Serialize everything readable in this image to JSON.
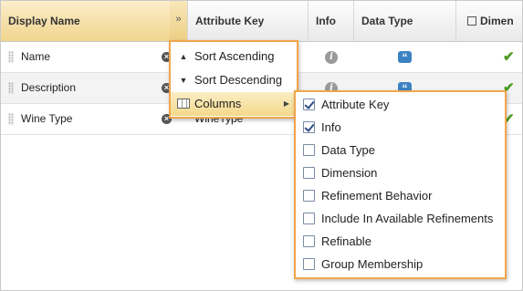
{
  "columns": {
    "display_name": "Display Name",
    "attribute_key": "Attribute Key",
    "info": "Info",
    "data_type": "Data Type",
    "dimension": "Dimen"
  },
  "trigger_glyph": "»",
  "rows": [
    {
      "name": "Name",
      "key": "",
      "info_glyph": "i",
      "type_glyph": "“",
      "dimension_checked": true
    },
    {
      "name": "Description",
      "key": "",
      "info_glyph": "i",
      "type_glyph": "“",
      "dimension_checked": true
    },
    {
      "name": "Wine Type",
      "key": "WineType",
      "info_glyph": "i",
      "type_glyph": "“",
      "dimension_checked": true
    }
  ],
  "column_menu": {
    "sort_ascending": "Sort Ascending",
    "sort_descending": "Sort Descending",
    "columns": "Columns"
  },
  "columns_submenu": [
    {
      "label": "Attribute Key",
      "checked": true
    },
    {
      "label": "Info",
      "checked": true
    },
    {
      "label": "Data Type",
      "checked": true
    },
    {
      "label": "Dimension",
      "checked": true
    },
    {
      "label": "Refinement Behavior",
      "checked": false
    },
    {
      "label": "Include In Available Refinements",
      "checked": false
    },
    {
      "label": "Refinable",
      "checked": false
    },
    {
      "label": "Group Membership",
      "checked": false
    }
  ],
  "colors": {
    "accent_border": "#f2a54b",
    "check_green": "#4c9b20",
    "type_blue": "#3c82c3"
  }
}
